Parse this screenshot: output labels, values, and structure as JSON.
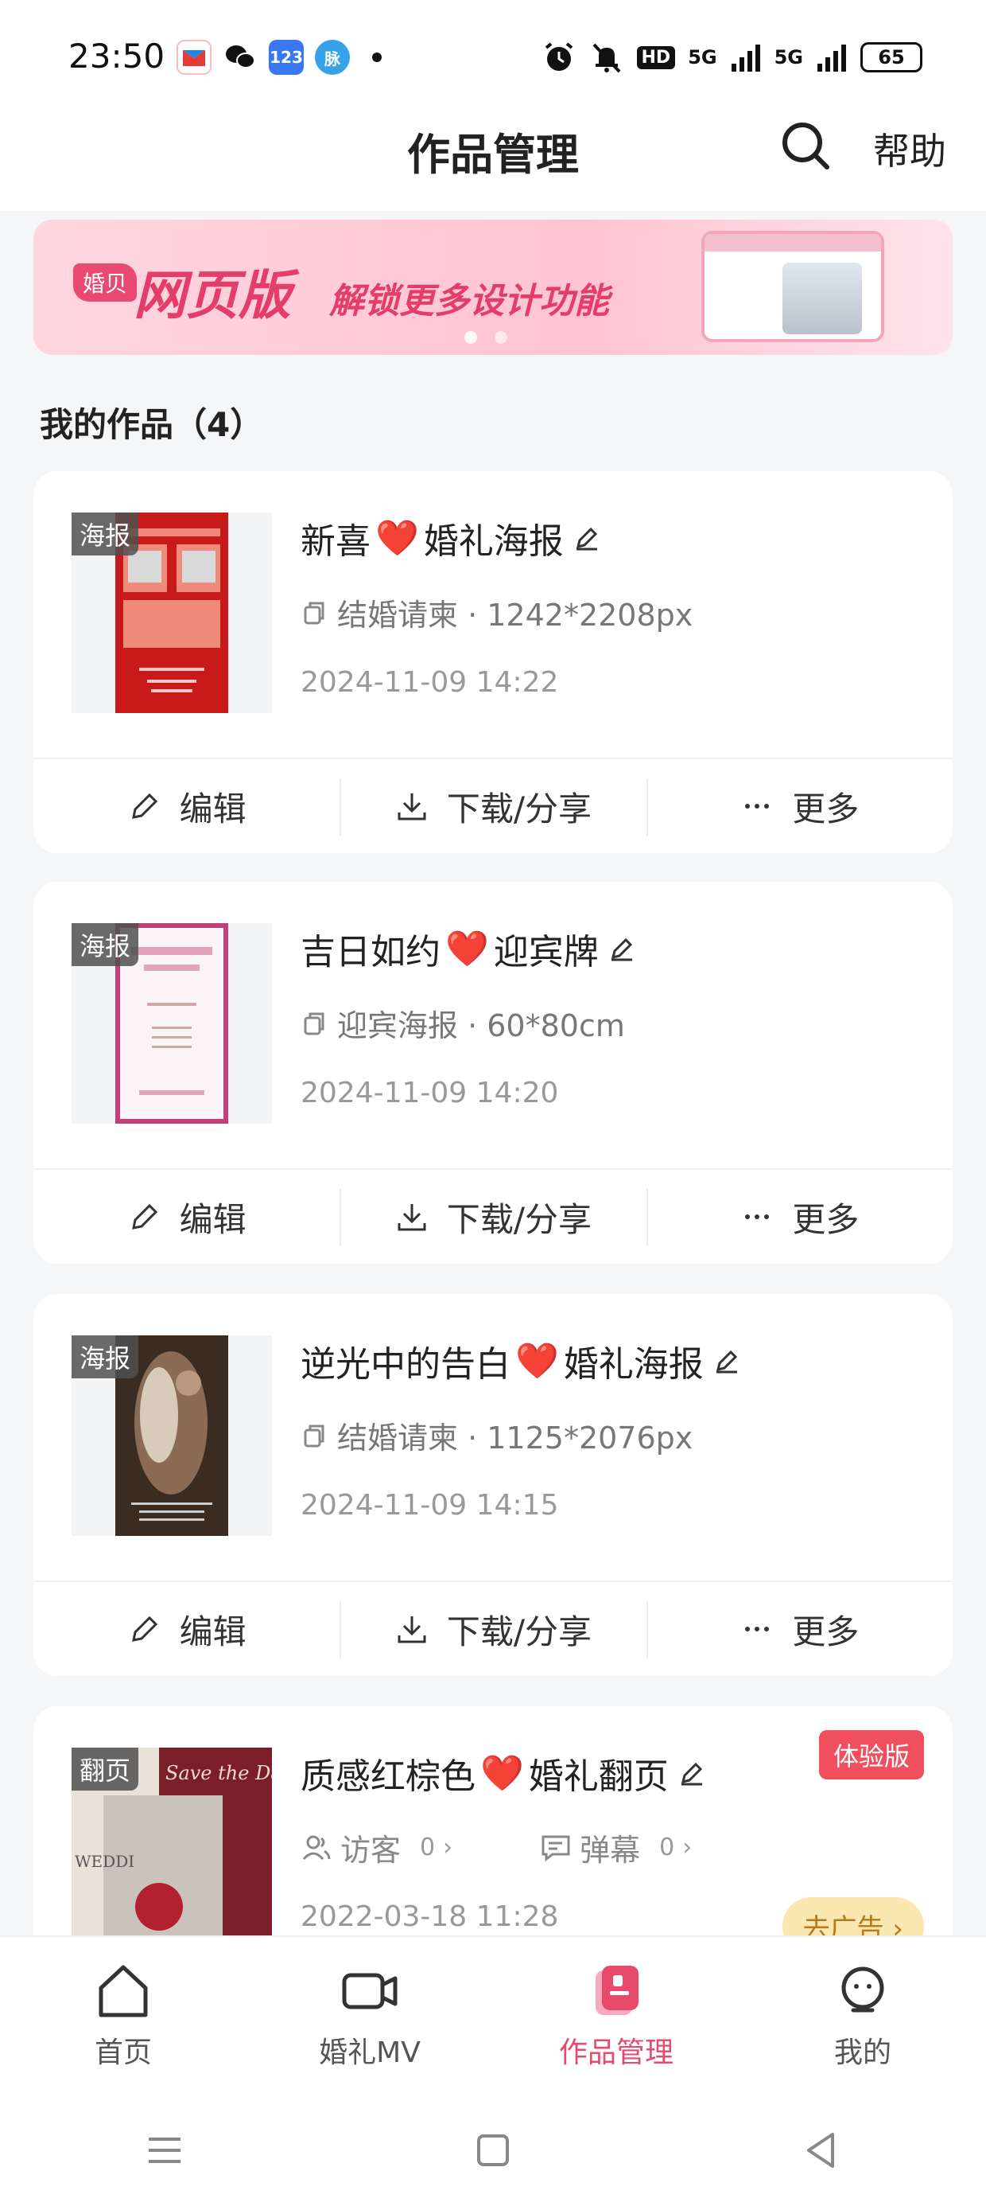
{
  "status_bar": {
    "time": "23:50",
    "app_icons": [
      "app-red-icon",
      "wechat-icon",
      "num-123-icon",
      "mai-icon"
    ],
    "app_labels": [
      "",
      "",
      "123",
      "脉"
    ],
    "hd_label": "HD",
    "sig_1": "5G",
    "sig_2": "5G",
    "battery": "65"
  },
  "header": {
    "title": "作品管理",
    "help": "帮助"
  },
  "banner": {
    "logo": "婚贝",
    "big": "网页版",
    "sub": "解锁更多设计功能"
  },
  "section": {
    "title": "我的作品（4）"
  },
  "cards": [
    {
      "badge": "海报",
      "title_a": "新喜",
      "heart": "❤️",
      "title_b": "婚礼海报",
      "meta": "结婚请柬 · 1242*2208px",
      "date": "2024-11-09 14:22"
    },
    {
      "badge": "海报",
      "title_a": "吉日如约",
      "heart": "❤️",
      "title_b": "迎宾牌",
      "meta": "迎宾海报 · 60*80cm",
      "date": "2024-11-09 14:20"
    },
    {
      "badge": "海报",
      "title_a": "逆光中的告白",
      "heart": "❤️",
      "title_b": "婚礼海报",
      "meta": "结婚请柬 · 1125*2076px",
      "date": "2024-11-09 14:15"
    },
    {
      "badge": "翻页",
      "title_a": "质感红棕色",
      "heart": "❤️",
      "title_b": "婚礼翻页",
      "trial": "体验版",
      "visitors_label": "访客",
      "visitors_count": "0",
      "danmu_label": "弹幕",
      "danmu_count": "0",
      "date": "2022-03-18 11:28",
      "ad_label": "去广告",
      "thumb_text_1": "Save the Date",
      "thumb_text_2": "WEDDI"
    }
  ],
  "actions": {
    "edit": "编辑",
    "download": "下载/分享",
    "more": "更多"
  },
  "bottom_nav": [
    {
      "label": "首页",
      "icon": "home-icon"
    },
    {
      "label": "婚礼MV",
      "icon": "video-icon"
    },
    {
      "label": "作品管理",
      "icon": "works-icon"
    },
    {
      "label": "我的",
      "icon": "profile-icon"
    }
  ],
  "colors": {
    "accent": "#e84a6e",
    "trial_badge": "#f0505e",
    "ad_button_bg": "#fbe7b0"
  }
}
